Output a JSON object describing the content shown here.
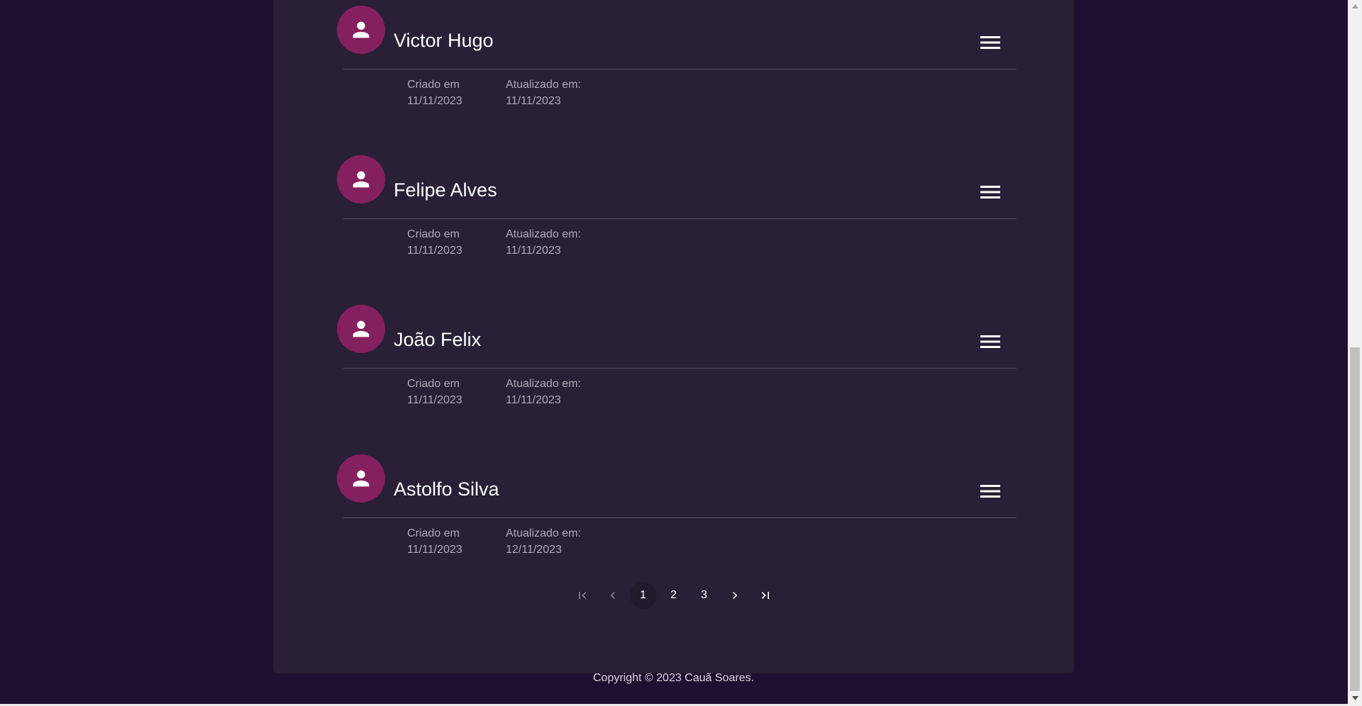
{
  "users": [
    {
      "name": "Victor Hugo",
      "created_label": "Criado em",
      "created_date": "11/11/2023",
      "updated_label": "Atualizado em:",
      "updated_date": "11/11/2023"
    },
    {
      "name": "Felipe Alves",
      "created_label": "Criado em",
      "created_date": "11/11/2023",
      "updated_label": "Atualizado em:",
      "updated_date": "11/11/2023"
    },
    {
      "name": "João Felix",
      "created_label": "Criado em",
      "created_date": "11/11/2023",
      "updated_label": "Atualizado em:",
      "updated_date": "11/11/2023"
    },
    {
      "name": "Astolfo Silva",
      "created_label": "Criado em",
      "created_date": "11/11/2023",
      "updated_label": "Atualizado em:",
      "updated_date": "12/11/2023"
    }
  ],
  "pagination": {
    "pages": [
      "1",
      "2",
      "3"
    ],
    "current_page": "1",
    "first_icon": "first-page-icon",
    "prev_icon": "chevron-left-icon",
    "next_icon": "chevron-right-icon",
    "last_icon": "last-page-icon"
  },
  "footer": {
    "copyright": "Copyright © 2023 Cauã Soares."
  },
  "colors": {
    "background": "#1e1030",
    "panel": "#291f36",
    "avatar": "#85205e",
    "divider": "#5a5064",
    "meta_text": "#b0a8ba"
  },
  "icons": {
    "avatar": "person-icon",
    "menu": "hamburger-menu-icon"
  }
}
